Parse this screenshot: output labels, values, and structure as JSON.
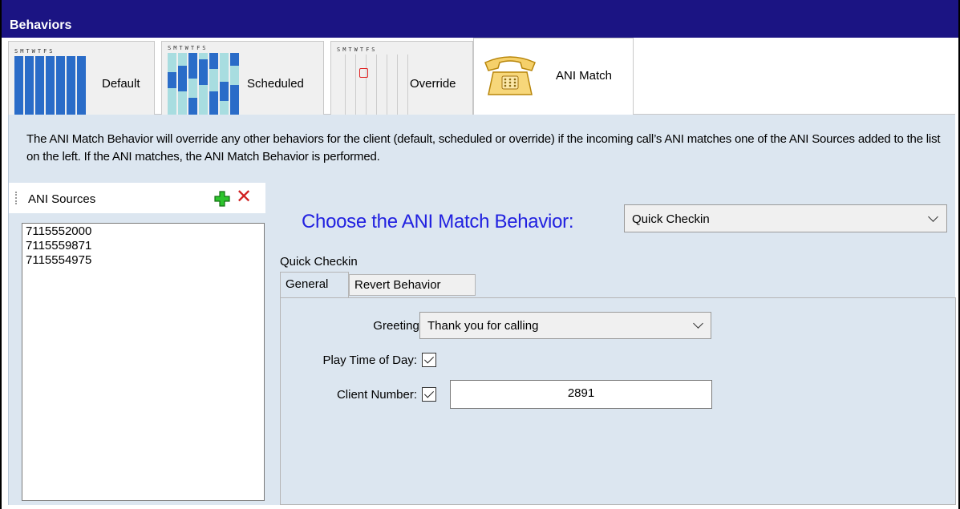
{
  "window": {
    "title": "Behaviors"
  },
  "tabs": [
    {
      "label": "Default",
      "icon": "calendar-default-icon",
      "cal_header": "SMTWTFS"
    },
    {
      "label": "Scheduled",
      "icon": "calendar-scheduled-icon",
      "cal_header": "SMTWTFS"
    },
    {
      "label": "Override",
      "icon": "calendar-override-icon",
      "cal_header": "SMTWTFS"
    },
    {
      "label": "ANI Match",
      "icon": "telephone-icon",
      "active": true
    }
  ],
  "description": "The ANI Match Behavior will override any other behaviors for the client (default, scheduled or override) if the incoming call’s ANI matches one of the ANI Sources added to the list on the left. If the ANI matches, the ANI Match Behavior is performed.",
  "ani_sources": {
    "title": "ANI Sources",
    "add_icon": "plus-icon",
    "delete_icon": "close-icon",
    "items": [
      "7115552000",
      "7115559871",
      "7115554975"
    ]
  },
  "behavior": {
    "choose_label": "Choose the ANI Match Behavior:",
    "selected": "Quick Checkin",
    "group_label": "Quick Checkin",
    "subtabs": [
      {
        "label": "General",
        "active": true
      },
      {
        "label": "Revert Behavior"
      }
    ],
    "general": {
      "greeting_label": "Greeting:",
      "greeting_value": "Thank you for calling",
      "play_time_label": "Play Time of Day:",
      "play_time_checked": true,
      "client_number_label": "Client Number:",
      "client_number_checked": true,
      "client_number_value": "2891"
    }
  },
  "colors": {
    "titlebar": "#1b1483",
    "content_bg": "#dce6f0",
    "choose_label": "#2121e0",
    "calendar_blue": "#2a6cc8"
  }
}
